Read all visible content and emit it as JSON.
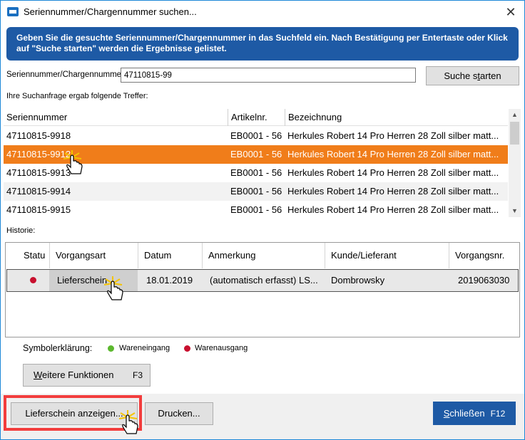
{
  "window": {
    "title": "Seriennummer/Chargennummer suchen...",
    "close_glyph": "✕"
  },
  "info": {
    "text": "Geben Sie die gesuchte Seriennummer/Chargennummer in das Suchfeld ein. Nach Bestätigung per Entertaste oder Klick auf \"Suche starten\" werden die Ergebnisse gelistet."
  },
  "search": {
    "label": "Seriennummer/Chargennummer:",
    "value": "47110815-99",
    "button_pre": "Suche s",
    "button_u": "t",
    "button_post": "arten"
  },
  "results": {
    "note": "Ihre Suchanfrage ergab folgende Treffer:",
    "columns": [
      "Seriennummer",
      "Artikelnr.",
      "Bezeichnung"
    ],
    "rows": [
      {
        "serial": "47110815-9918",
        "article": "EB0001 - 56",
        "desc": "Herkules Robert 14 Pro Herren 28 Zoll silber matt..."
      },
      {
        "serial": "47110815-9912",
        "article": "EB0001 - 56",
        "desc": "Herkules Robert 14 Pro Herren 28 Zoll silber matt..."
      },
      {
        "serial": "47110815-9913",
        "article": "EB0001 - 56",
        "desc": "Herkules Robert 14 Pro Herren 28 Zoll silber matt..."
      },
      {
        "serial": "47110815-9914",
        "article": "EB0001 - 56",
        "desc": "Herkules Robert 14 Pro Herren 28 Zoll silber matt..."
      },
      {
        "serial": "47110815-9915",
        "article": "EB0001 - 56",
        "desc": "Herkules Robert 14 Pro Herren 28 Zoll silber matt..."
      }
    ],
    "selected_index": 1
  },
  "history": {
    "label": "Historie:",
    "columns": [
      "Statu",
      "Vorgangsart",
      "Datum",
      "Anmerkung",
      "Kunde/Lieferant",
      "Vorgangsnr."
    ],
    "rows": [
      {
        "status": "warenausgang",
        "type": "Lieferschein",
        "date": "18.01.2019",
        "note": "(automatisch erfasst) LS...",
        "customer": "Dombrowsky",
        "number": "2019063030"
      }
    ]
  },
  "legend": {
    "title": "Symbolerklärung:",
    "items": [
      {
        "label": "Wareneingang",
        "color": "#5cb82e"
      },
      {
        "label": "Warenausgang",
        "color": "#c8102e"
      }
    ]
  },
  "buttons": {
    "weitere_u": "W",
    "weitere_rest": "eitere Funktionen",
    "weitere_key": "F3",
    "lieferschein": "Lieferschein anzeigen...",
    "drucken": "Drucken...",
    "close_u": "S",
    "close_rest": "chließen",
    "close_key": "F12"
  },
  "colors": {
    "accent_blue": "#1e5aa5",
    "selection_orange": "#f07d1a",
    "highlight_red": "#f23d3d"
  }
}
